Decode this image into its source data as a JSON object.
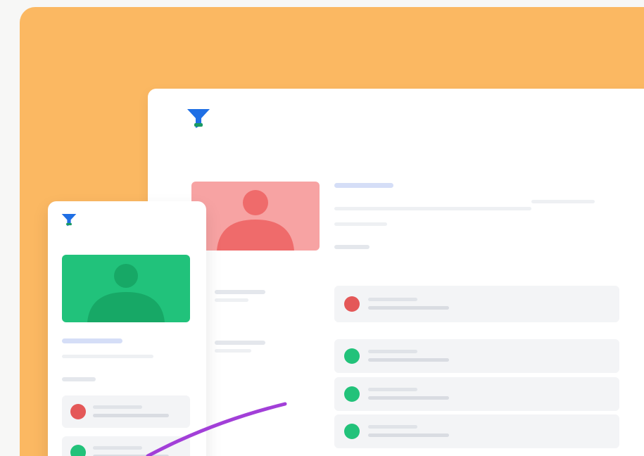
{
  "illustration": {
    "backdrop_color": "#fbb862",
    "back_card": {
      "logo_icon": "funnel-icon",
      "logo_color": "#1f6fe5",
      "avatar_icon": "user-silhouette-icon",
      "avatar_bg": "#f7a3a3",
      "avatar_fg": "#ef6b6b",
      "list_items": [
        {
          "status": "red",
          "color": "#e45858"
        },
        {
          "status": "green",
          "color": "#22c27a"
        },
        {
          "status": "green",
          "color": "#22c27a"
        },
        {
          "status": "green",
          "color": "#22c27a"
        }
      ]
    },
    "front_card": {
      "logo_icon": "funnel-icon",
      "logo_color": "#1f6fe5",
      "avatar_icon": "user-silhouette-icon",
      "avatar_bg": "#21c27b",
      "avatar_fg": "#17a866",
      "list_items": [
        {
          "status": "red",
          "color": "#e45858"
        },
        {
          "status": "green",
          "color": "#22c27a"
        }
      ]
    },
    "connector_color": "#a23fd8"
  }
}
